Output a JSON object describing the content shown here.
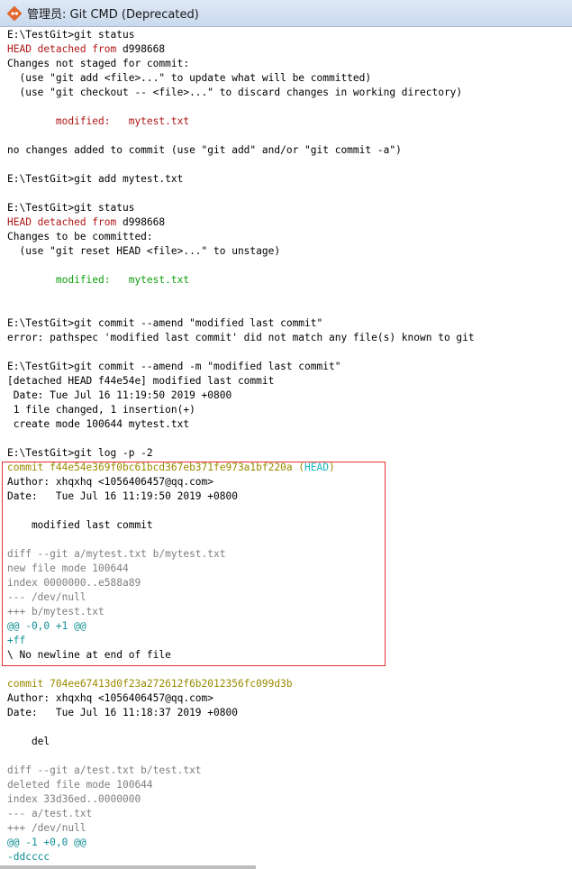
{
  "window": {
    "title_prefix": "管理员:",
    "title": "Git CMD (Deprecated)"
  },
  "colors": {
    "highlight_border": "#e03030",
    "modified_unstaged": "#b01616",
    "modified_staged": "#12a012",
    "commit_hash": "#9a8a00",
    "diff_meta": "#7e7e7e",
    "diff_hunk": "#118f94"
  },
  "console_lines": [
    {
      "t": "E:\\TestGit>git status",
      "c": "default"
    },
    {
      "t": "HEAD detached from d998668",
      "c": "red",
      "mixed": [
        {
          "t": "HEAD detached from",
          "c": "red"
        },
        {
          "t": " d998668",
          "c": "default"
        }
      ]
    },
    {
      "t": "Changes not staged for commit:",
      "c": "default"
    },
    {
      "t": "  (use \"git add <file>...\" to update what will be committed)",
      "c": "default"
    },
    {
      "t": "  (use \"git checkout -- <file>...\" to discard changes in working directory)",
      "c": "default"
    },
    {
      "t": "",
      "c": "default"
    },
    {
      "t": "        modified:   mytest.txt",
      "c": "red"
    },
    {
      "t": "",
      "c": "default"
    },
    {
      "t": "no changes added to commit (use \"git add\" and/or \"git commit -a\")",
      "c": "default"
    },
    {
      "t": "",
      "c": "default"
    },
    {
      "t": "E:\\TestGit>git add mytest.txt",
      "c": "default"
    },
    {
      "t": "",
      "c": "default"
    },
    {
      "t": "E:\\TestGit>git status",
      "c": "default"
    },
    {
      "t": "HEAD detached from d998668",
      "c": "red",
      "mixed": [
        {
          "t": "HEAD detached from",
          "c": "red"
        },
        {
          "t": " d998668",
          "c": "default"
        }
      ]
    },
    {
      "t": "Changes to be committed:",
      "c": "default"
    },
    {
      "t": "  (use \"git reset HEAD <file>...\" to unstage)",
      "c": "default"
    },
    {
      "t": "",
      "c": "default"
    },
    {
      "t": "        modified:   mytest.txt",
      "c": "green"
    },
    {
      "t": "",
      "c": "default"
    },
    {
      "t": "",
      "c": "default"
    },
    {
      "t": "E:\\TestGit>git commit --amend \"modified last commit\"",
      "c": "default"
    },
    {
      "t": "error: pathspec 'modified last commit' did not match any file(s) known to git",
      "c": "default"
    },
    {
      "t": "",
      "c": "default"
    },
    {
      "t": "E:\\TestGit>git commit --amend -m \"modified last commit\"",
      "c": "default"
    },
    {
      "t": "[detached HEAD f44e54e] modified last commit",
      "c": "default"
    },
    {
      "t": " Date: Tue Jul 16 11:19:50 2019 +0800",
      "c": "default"
    },
    {
      "t": " 1 file changed, 1 insertion(+)",
      "c": "default"
    },
    {
      "t": " create mode 100644 mytest.txt",
      "c": "default"
    },
    {
      "t": "",
      "c": "default"
    },
    {
      "t": "E:\\TestGit>git log -p -2",
      "c": "default"
    },
    {
      "t": "commit f44e54e369f0bc61bcd367eb371fe973a1bf220a (HEAD)",
      "c": "yellow",
      "mixed": [
        {
          "t": "commit f44e54e369f0bc61bcd367eb371fe973a1bf220a (",
          "c": "yellow"
        },
        {
          "t": "HEAD",
          "c": "cyan-light"
        },
        {
          "t": ")",
          "c": "yellow"
        }
      ]
    },
    {
      "t": "Author: xhqxhq <1056406457@qq.com>",
      "c": "default"
    },
    {
      "t": "Date:   Tue Jul 16 11:19:50 2019 +0800",
      "c": "default"
    },
    {
      "t": "",
      "c": "default"
    },
    {
      "t": "    modified last commit",
      "c": "default"
    },
    {
      "t": "",
      "c": "default"
    },
    {
      "t": "diff --git a/mytest.txt b/mytest.txt",
      "c": "gray"
    },
    {
      "t": "new file mode 100644",
      "c": "gray"
    },
    {
      "t": "index 0000000..e588a89",
      "c": "gray"
    },
    {
      "t": "--- /dev/null",
      "c": "gray"
    },
    {
      "t": "+++ b/mytest.txt",
      "c": "gray"
    },
    {
      "t": "@@ -0,0 +1 @@",
      "c": "cyan"
    },
    {
      "t": "+ff",
      "c": "cyan"
    },
    {
      "t": "\\ No newline at end of file",
      "c": "default"
    },
    {
      "t": "",
      "c": "default"
    },
    {
      "t": "commit 704ee67413d0f23a272612f6b2012356fc099d3b",
      "c": "yellow"
    },
    {
      "t": "Author: xhqxhq <1056406457@qq.com>",
      "c": "default"
    },
    {
      "t": "Date:   Tue Jul 16 11:18:37 2019 +0800",
      "c": "default"
    },
    {
      "t": "",
      "c": "default"
    },
    {
      "t": "    del",
      "c": "default"
    },
    {
      "t": "",
      "c": "default"
    },
    {
      "t": "diff --git a/test.txt b/test.txt",
      "c": "gray"
    },
    {
      "t": "deleted file mode 100644",
      "c": "gray"
    },
    {
      "t": "index 33d36ed..0000000",
      "c": "gray"
    },
    {
      "t": "--- a/test.txt",
      "c": "gray"
    },
    {
      "t": "+++ /dev/null",
      "c": "gray"
    },
    {
      "t": "@@ -1 +0,0 @@",
      "c": "cyan"
    },
    {
      "t": "-ddcccc",
      "c": "cyan"
    }
  ]
}
